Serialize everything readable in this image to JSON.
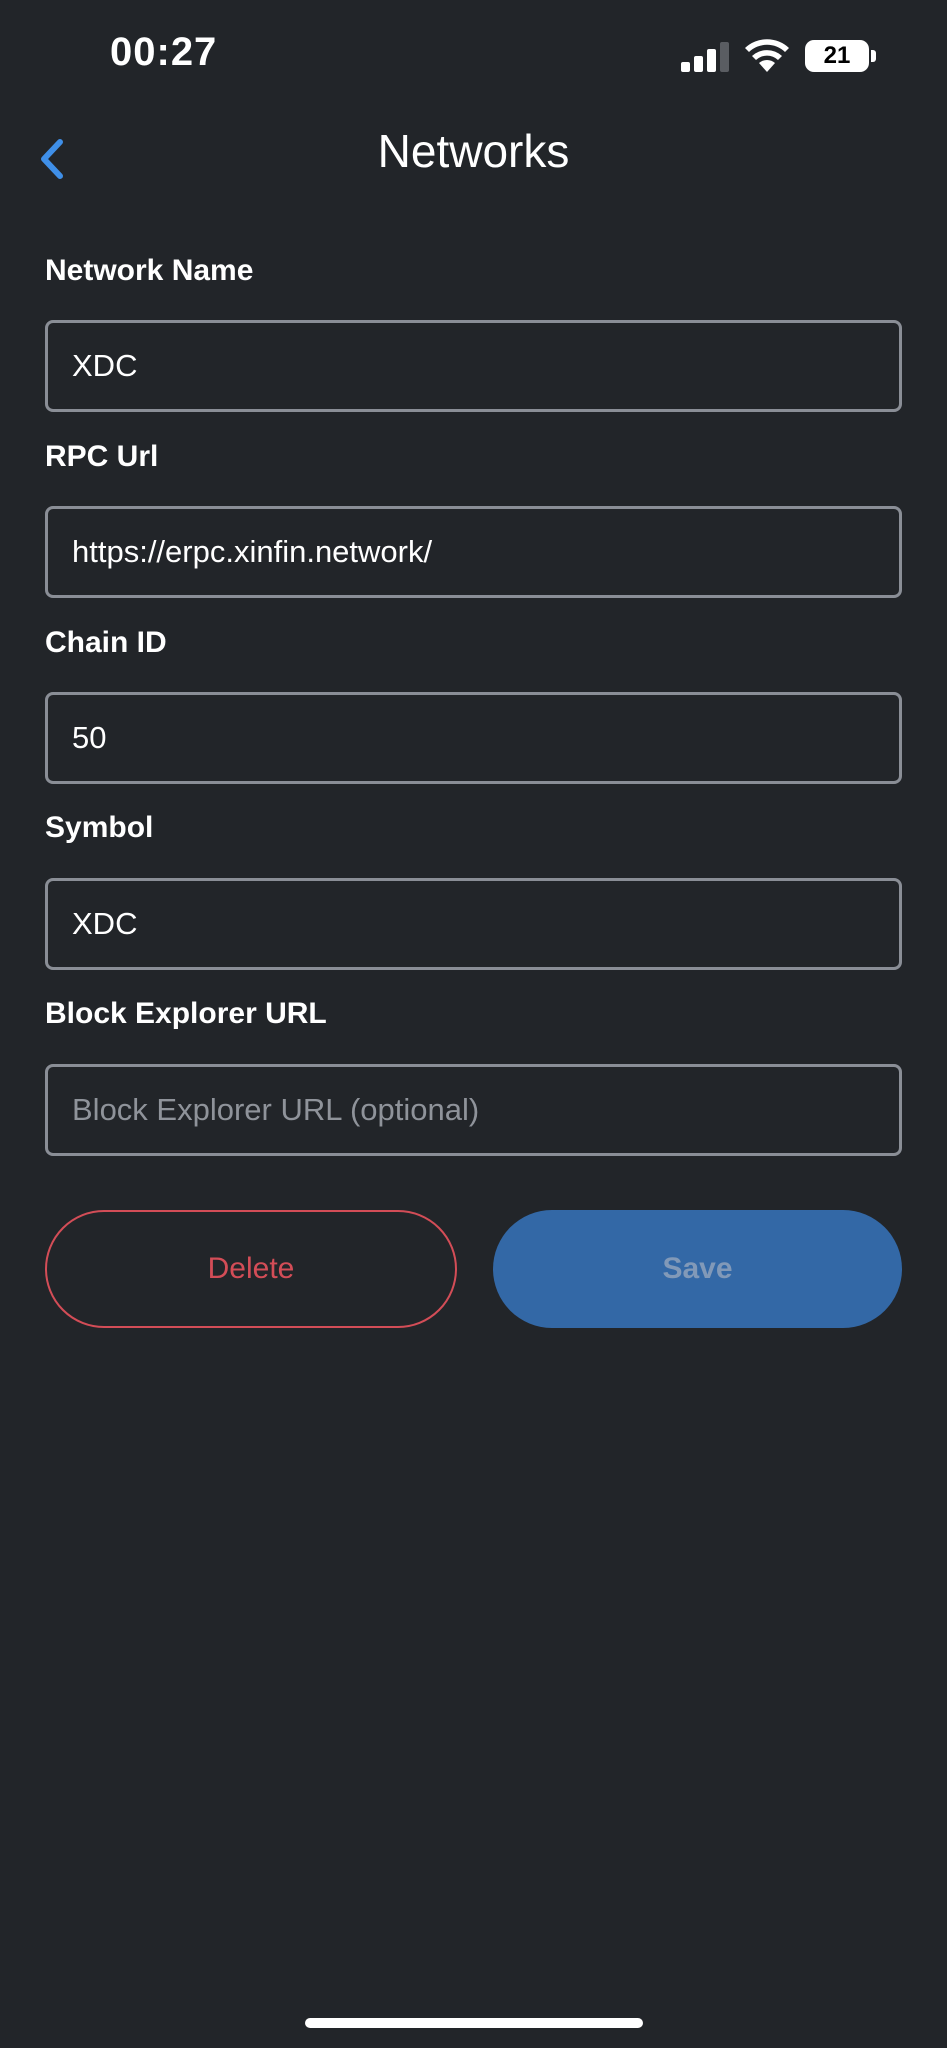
{
  "status_bar": {
    "time": "00:27",
    "battery_level": "21",
    "signal_icon": "cellular-signal-icon",
    "wifi_icon": "wifi-icon",
    "battery_icon": "battery-icon"
  },
  "header": {
    "title": "Networks",
    "back_icon": "chevron-left-icon",
    "accent_color": "#3f8fe8"
  },
  "form": {
    "network_name": {
      "label": "Network Name",
      "value": "XDC",
      "placeholder": ""
    },
    "rpc_url": {
      "label": "RPC Url",
      "value": "https://erpc.xinfin.network/",
      "placeholder": ""
    },
    "chain_id": {
      "label": "Chain ID",
      "value": "50",
      "placeholder": ""
    },
    "symbol": {
      "label": "Symbol",
      "value": "XDC",
      "placeholder": ""
    },
    "block_explorer_url": {
      "label": "Block Explorer URL",
      "value": "",
      "placeholder": "Block Explorer URL (optional)"
    }
  },
  "actions": {
    "delete_label": "Delete",
    "save_label": "Save",
    "delete_color": "#d34d57",
    "save_color": "#3368a6"
  },
  "colors": {
    "background": "#222529",
    "input_border": "#8a8e96"
  }
}
